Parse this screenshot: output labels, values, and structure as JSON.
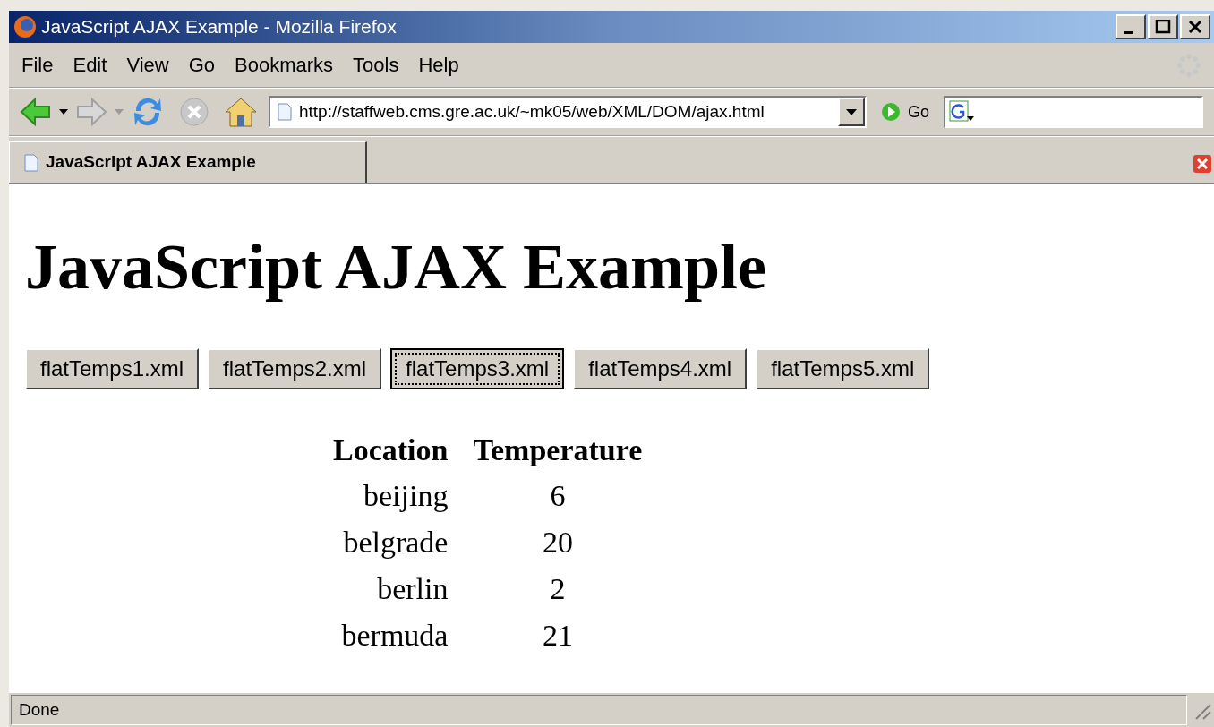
{
  "window": {
    "title": "JavaScript AJAX Example - Mozilla Firefox"
  },
  "menu": [
    {
      "label": "File"
    },
    {
      "label": "Edit"
    },
    {
      "label": "View"
    },
    {
      "label": "Go"
    },
    {
      "label": "Bookmarks"
    },
    {
      "label": "Tools"
    },
    {
      "label": "Help"
    }
  ],
  "toolbar": {
    "address": "http://staffweb.cms.gre.ac.uk/~mk05/web/XML/DOM/ajax.html",
    "go": "Go"
  },
  "tabs": [
    {
      "label": "JavaScript AJAX Example",
      "selected": true
    }
  ],
  "page": {
    "heading": "JavaScript AJAX Example",
    "buttons": [
      {
        "label": "flatTemps1.xml",
        "selected": false
      },
      {
        "label": "flatTemps2.xml",
        "selected": false
      },
      {
        "label": "flatTemps3.xml",
        "selected": true
      },
      {
        "label": "flatTemps4.xml",
        "selected": false
      },
      {
        "label": "flatTemps5.xml",
        "selected": false
      }
    ],
    "table": {
      "columns": [
        "Location",
        "Temperature"
      ],
      "rows": [
        [
          "beijing",
          "6"
        ],
        [
          "belgrade",
          "20"
        ],
        [
          "berlin",
          "2"
        ],
        [
          "bermuda",
          "21"
        ]
      ]
    }
  },
  "status_bar": "Done"
}
